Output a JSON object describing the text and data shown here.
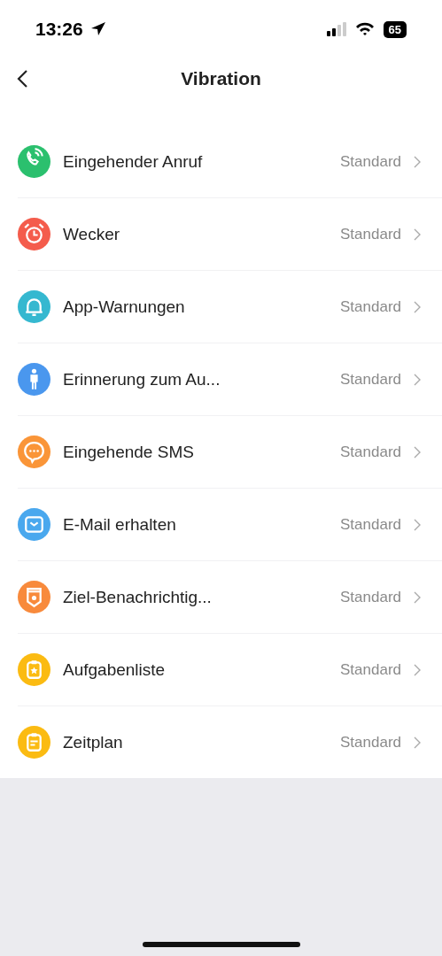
{
  "status_bar": {
    "time": "13:26",
    "battery": "65"
  },
  "nav": {
    "title": "Vibration"
  },
  "items": [
    {
      "kind": "phone",
      "color": "#2bc06e",
      "label": "Eingehender Anruf",
      "value": "Standard"
    },
    {
      "kind": "alarm",
      "color": "#f45c4c",
      "label": "Wecker",
      "value": "Standard"
    },
    {
      "kind": "bell",
      "color": "#35b8d0",
      "label": "App-Warnungen",
      "value": "Standard"
    },
    {
      "kind": "person",
      "color": "#4a97ee",
      "label": "Erinnerung zum Au...",
      "value": "Standard"
    },
    {
      "kind": "chat",
      "color": "#fa9538",
      "label": "Eingehende SMS",
      "value": "Standard"
    },
    {
      "kind": "mail",
      "color": "#4aa8ee",
      "label": "E-Mail erhalten",
      "value": "Standard"
    },
    {
      "kind": "badge",
      "color": "#f88a3c",
      "label": "Ziel-Benachrichtig...",
      "value": "Standard"
    },
    {
      "kind": "clipstar",
      "color": "#fbbb12",
      "label": "Aufgabenliste",
      "value": "Standard"
    },
    {
      "kind": "cliplist",
      "color": "#fbbb12",
      "label": "Zeitplan",
      "value": "Standard"
    }
  ]
}
